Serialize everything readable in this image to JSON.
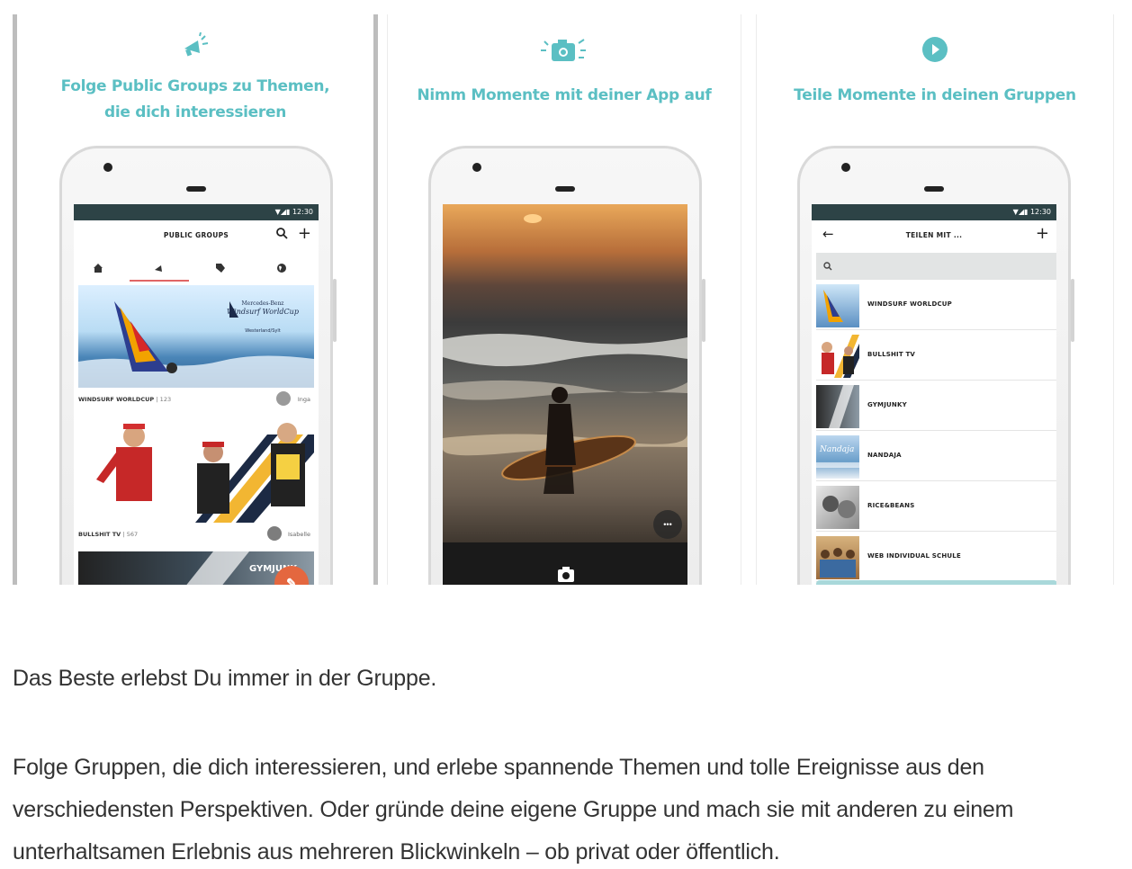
{
  "screenshots": [
    {
      "title_line1": "Folge Public Groups zu Themen,",
      "title_line2": "die dich interessieren",
      "icon": "megaphone-icon",
      "phone": {
        "status_time": "12:30",
        "header_title": "PUBLIC GROUPS",
        "tabs": [
          "home-icon",
          "megaphone-icon",
          "tag-icon",
          "globe-icon"
        ],
        "items": [
          {
            "name": "WINDSURF WORLDCUP",
            "count": "| 123",
            "user": "Inga"
          },
          {
            "name": "BULLSHIT TV",
            "count": "| 567",
            "user": "Isabelle"
          },
          {
            "name": "GYMJUNKY",
            "count": "",
            "user": ""
          }
        ]
      }
    },
    {
      "title": "Nimm Momente mit deiner App auf",
      "icon": "camera-icon",
      "phone": {
        "more_label": "•••"
      }
    },
    {
      "title": "Teile Momente in deinen Gruppen",
      "icon": "play-icon",
      "phone": {
        "status_time": "12:30",
        "header_title": "TEILEN MIT ...",
        "groups": [
          "WINDSURF WORLDCUP",
          "BULLSHIT TV",
          "GYMJUNKY",
          "NANDAJA",
          "RICE&BEANS",
          "WEB INDIVIDUAL SCHULE"
        ]
      }
    }
  ],
  "description": {
    "lead": "Das Beste erlebst Du immer in der Gruppe.",
    "body_line1": "Folge Gruppen, die dich interessieren, und erlebe spannende Themen und tolle Ereignisse aus den",
    "body_line2": "verschiedensten Perspektiven. Oder gründe deine eigene Gruppe und mach sie mit anderen zu einem",
    "body_line3": "unterhaltsamen Erlebnis aus mehreren Blickwinkeln – ob privat oder öffentlich."
  },
  "colors": {
    "accent": "#5bbfc3",
    "statusbar": "#2d4346",
    "tab_underline": "#e06666"
  }
}
